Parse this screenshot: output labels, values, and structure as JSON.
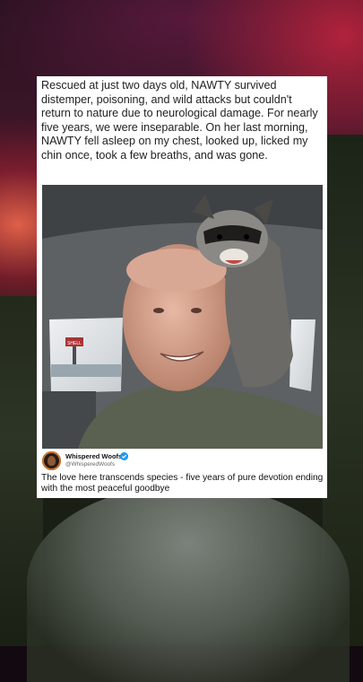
{
  "post": {
    "caption": "Rescued at just two days old, NAWTY survived distemper, poisoning, and wild attacks but couldn't return to nature due to neurological damage. For nearly five years, we were inseparable. On her last morning, NAWTY fell asleep on my chest, looked up,  licked my chin once, took a few breaths, and was gone.",
    "account_name": "Whispered Woofs",
    "handle": "@WhisperedWoofs",
    "text": "The love here transcends species - five years of pure devotion ending with the most peaceful goodbye"
  },
  "photo": {
    "sign_text": "SHELL"
  },
  "colors": {
    "verified": "#1d9bf0",
    "card": "#ffffff"
  },
  "icons": {
    "verified": "verified-badge-icon",
    "avatar": "avatar"
  }
}
